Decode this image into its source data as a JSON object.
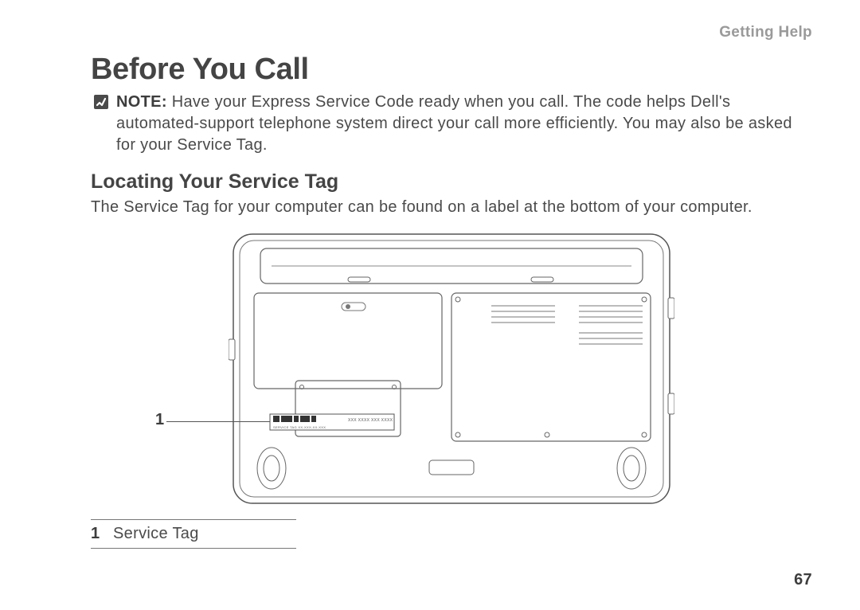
{
  "header": {
    "running_head": "Getting Help"
  },
  "section": {
    "title": "Before You Call",
    "note_label": "NOTE:",
    "note_body": "Have your Express Service Code ready when you call. The code helps Dell's automated-support telephone system direct your call more efficiently. You may also be asked for your Service Tag.",
    "subtitle": "Locating Your Service Tag",
    "body": "The Service Tag for your computer can be found on a label at the bottom of your computer."
  },
  "figure": {
    "callout_1_number": "1",
    "legend": {
      "items": [
        {
          "num": "1",
          "text": "Service Tag"
        }
      ]
    }
  },
  "page_number": "67"
}
